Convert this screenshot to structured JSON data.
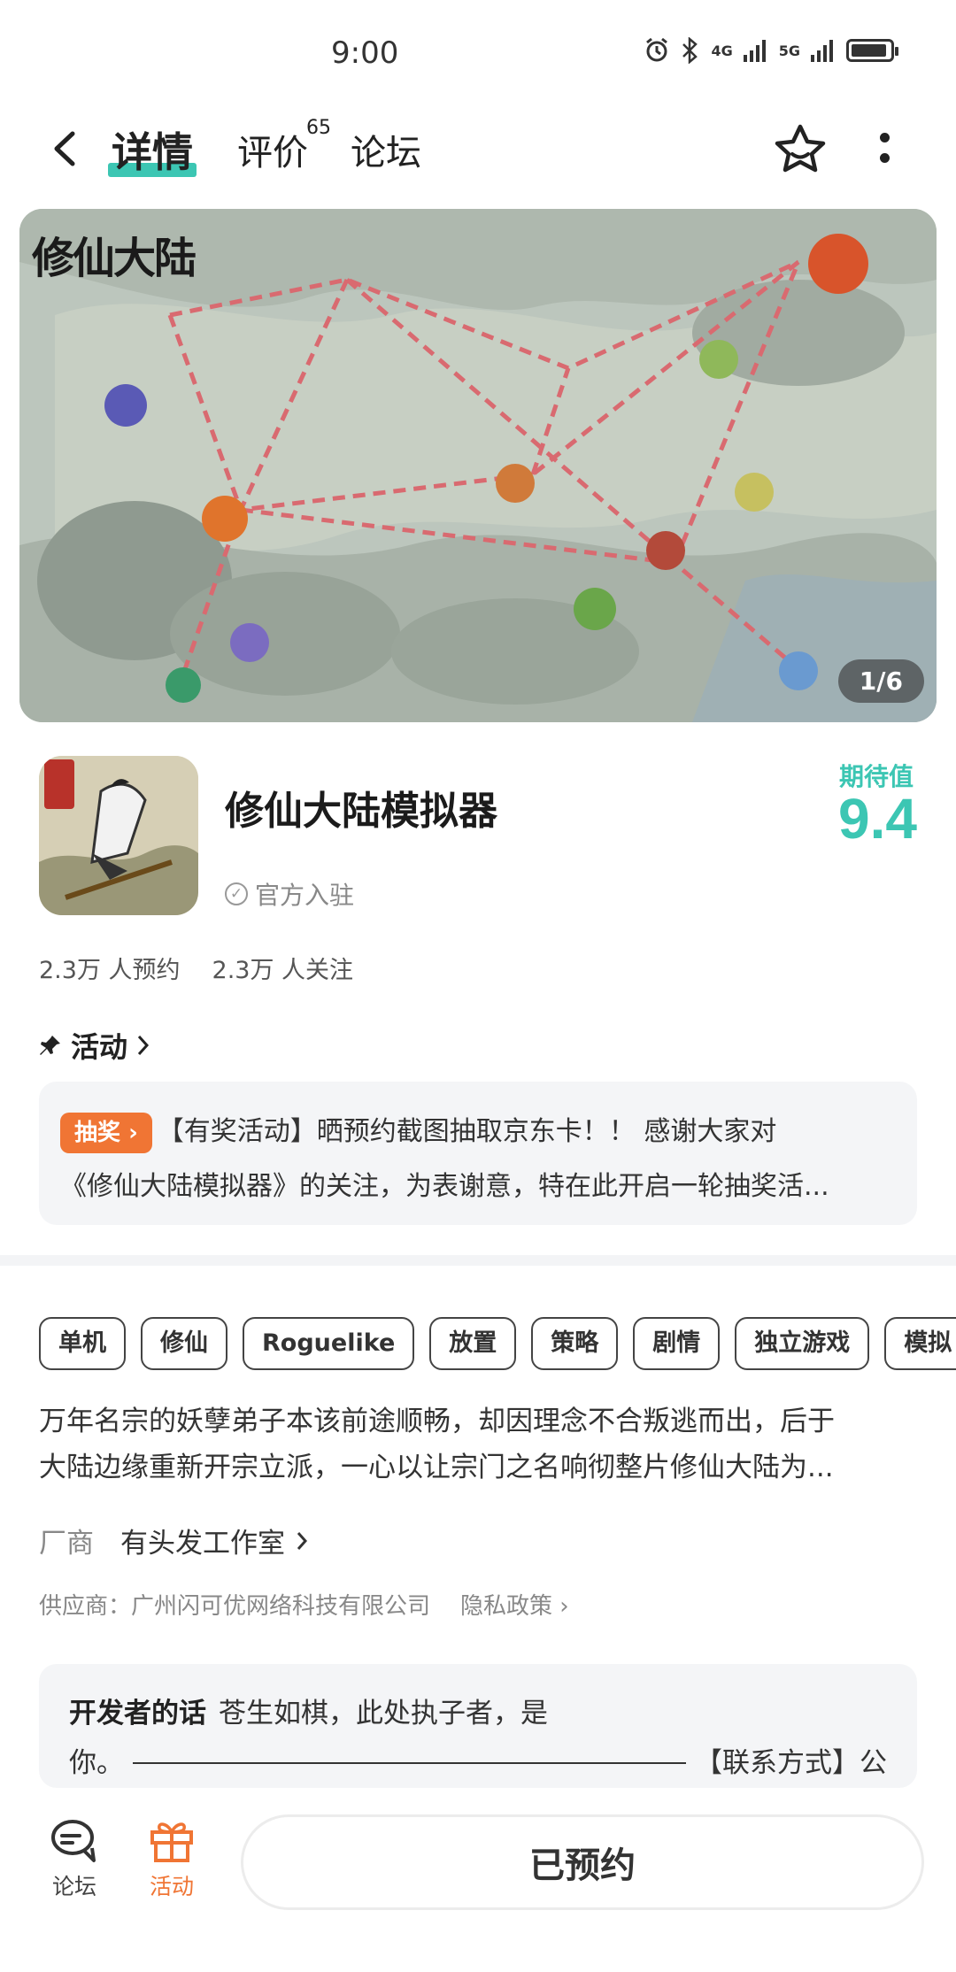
{
  "status_bar": {
    "time": "9:00",
    "net1": "4G",
    "net2": "5G"
  },
  "nav": {
    "tabs": [
      {
        "label": "详情",
        "active": true
      },
      {
        "label": "评价",
        "badge": "65"
      },
      {
        "label": "论坛"
      }
    ]
  },
  "banner": {
    "logo_text": "修仙大陆",
    "counter": "1/6"
  },
  "app": {
    "title": "修仙大陆模拟器",
    "official": "官方入驻",
    "expect_label": "期待值",
    "expect_value": "9.4",
    "reservations": "2.3万 人预约",
    "follows": "2.3万 人关注"
  },
  "activity": {
    "heading": "活动",
    "badge": "抽奖",
    "line1": "【有奖活动】晒预约截图抽取京东卡！！ 感谢大家对",
    "line2": "《修仙大陆模拟器》的关注，为表谢意，特在此开启一轮抽奖活..."
  },
  "tags": [
    "单机",
    "修仙",
    "Roguelike",
    "放置",
    "策略",
    "剧情",
    "独立游戏",
    "模拟"
  ],
  "description": {
    "line1": "万年名宗的妖孽弟子本该前途顺畅，却因理念不合叛逃而出，后于",
    "line2": "大陆边缘重新开宗立派，一心以让宗门之名响彻整片修仙大陆为..."
  },
  "maker": {
    "label": "厂商",
    "value": "有头发工作室"
  },
  "supplier": {
    "text": "供应商：广州闪可优网络科技有限公司",
    "privacy": "隐私政策"
  },
  "developer": {
    "label": "开发者的话",
    "line1": "苍生如棋，此处执子者，是",
    "line2_start": "你。",
    "line2_end": "【联系方式】公"
  },
  "bottom": {
    "forum": "论坛",
    "activity": "活动",
    "reserved": "已预约"
  },
  "colors": {
    "accent": "#3cc6b3",
    "orange": "#f07534"
  }
}
